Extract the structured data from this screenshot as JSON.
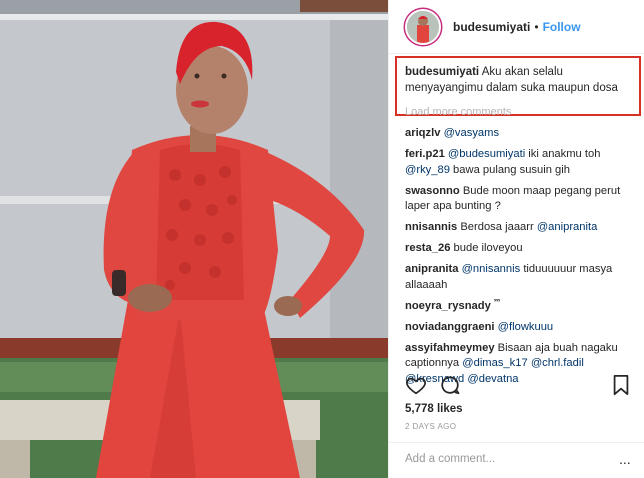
{
  "post": {
    "username": "budesumiyati",
    "separator": "•",
    "follow_label": "Follow"
  },
  "caption": {
    "username": "budesumiyati",
    "text": "Aku akan selalu menyayangimu dalam suka maupun dosa"
  },
  "load_more_label": "Load more comments",
  "comments": [
    {
      "user": "ariqzlv",
      "mention": "@vasyams",
      "text": ""
    },
    {
      "user": "feri.p21",
      "mention": "@budesumiyati",
      "text": " iki anakmu toh ",
      "mention2": "@rky_89",
      "text2": " bawa pulang susuin gih"
    },
    {
      "user": "swasonno",
      "text": "Bude moon maap pegang perut laper apa bunting ?"
    },
    {
      "user": "nnisannis",
      "text": "Berdosa jaaarr ",
      "mention": "@anipranita"
    },
    {
      "user": "resta_26",
      "text": "bude iloveyou"
    },
    {
      "user": "anipranita",
      "mention": "@nnisannis",
      "text": " tiduuuuuur masya allaaaah"
    },
    {
      "user": "noeyra_rysnady",
      "text": "𝄒𝄒𝄒"
    },
    {
      "user": "noviadanggraeni",
      "mention": "@flowkuuu",
      "text": ""
    },
    {
      "user": "assyifahmeymey",
      "text": "Bisaan aja buah nagaku captionnya ",
      "mention": "@dimas_k17",
      "mention2": "@chrl.fadil",
      "mention3": "@kresnawd",
      "mention4": "@devatna"
    }
  ],
  "icons": {
    "like": "heart-icon",
    "comment": "comment-icon",
    "save": "bookmark-icon",
    "more": "more-dots-icon"
  },
  "likes": "5,778 likes",
  "date": "2 DAYS AGO",
  "add_comment": {
    "placeholder": "Add a comment...",
    "more": "..."
  },
  "colors": {
    "link": "#3897f0",
    "mention": "#003569",
    "highlight_border": "#d93025",
    "dress": "#e8453c"
  }
}
